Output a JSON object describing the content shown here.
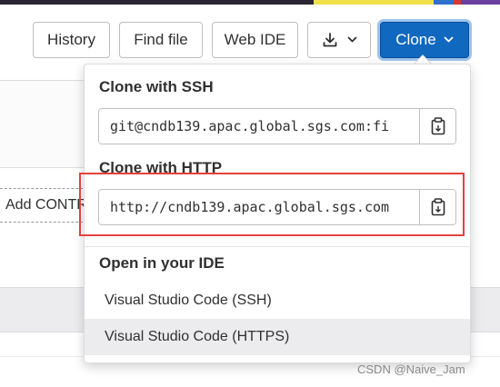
{
  "toolbar": {
    "history_label": "History",
    "find_file_label": "Find file",
    "web_ide_label": "Web IDE",
    "clone_label": "Clone"
  },
  "background": {
    "input_value": "Add CONTRIBUTING"
  },
  "clone_dropdown": {
    "ssh_heading": "Clone with SSH",
    "ssh_url": "git@cndb139.apac.global.sgs.com:fi",
    "http_heading": "Clone with HTTP",
    "http_url": "http://cndb139.apac.global.sgs.com",
    "ide_heading": "Open in your IDE",
    "ide_items": [
      {
        "label": "Visual Studio Code (SSH)"
      },
      {
        "label": "Visual Studio Code (HTTPS)"
      }
    ]
  },
  "icons": {
    "download": "download-icon",
    "chevron": "chevron-down-icon",
    "copy": "copy-to-clipboard-icon"
  },
  "colors": {
    "clone_button": "#1068bf",
    "highlight_box": "#e5413f"
  },
  "watermark": "CSDN @Naive_Jam"
}
